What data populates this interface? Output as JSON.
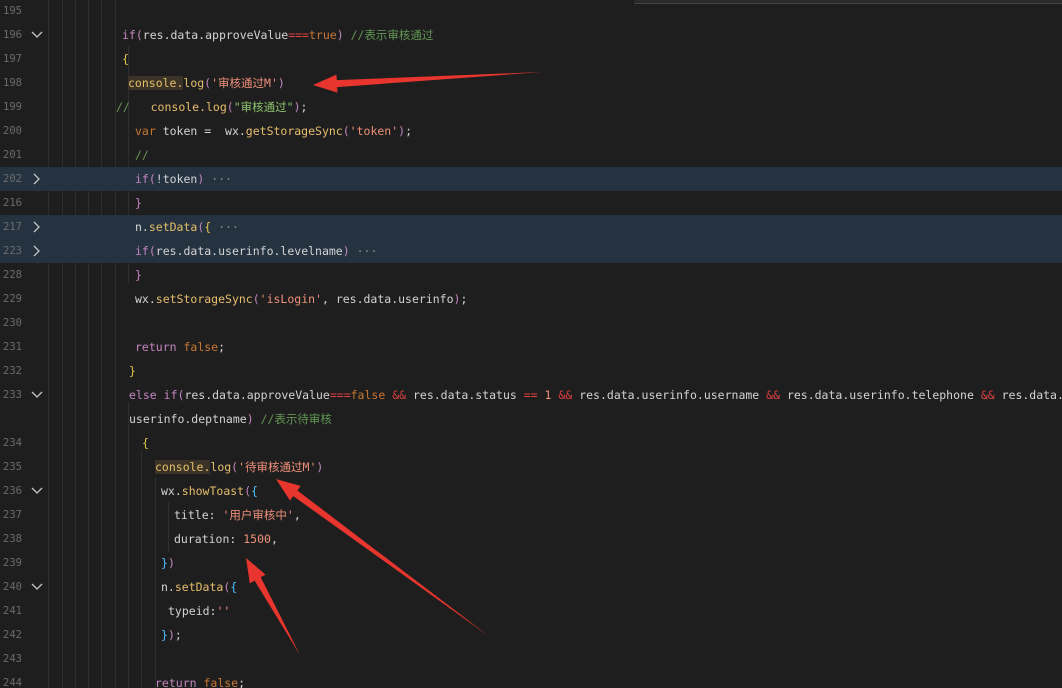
{
  "lines": [
    {
      "no": "195",
      "indent": 0,
      "segs": []
    },
    {
      "no": "196",
      "fold": "open",
      "indent": 122,
      "segs": [
        [
          "kw",
          "if"
        ],
        [
          "brk2",
          "("
        ],
        [
          "prop",
          "res.data.approveValue"
        ],
        [
          "op",
          "==="
        ],
        [
          "bool",
          "true"
        ],
        [
          "brk2",
          ")"
        ],
        [
          "plain",
          " "
        ],
        [
          "cm",
          "//表示审核通过"
        ]
      ]
    },
    {
      "no": "197",
      "indent": 122,
      "segs": [
        [
          "brk1",
          "{"
        ]
      ]
    },
    {
      "no": "198",
      "indent": 128,
      "segs": [
        [
          "hlfn",
          "console."
        ],
        [
          "fn",
          "log"
        ],
        [
          "brk2",
          "("
        ],
        [
          "str",
          "'审核通过M'"
        ],
        [
          "brk2",
          ")"
        ]
      ]
    },
    {
      "no": "199",
      "indent": 116,
      "segs": [
        [
          "cm",
          "//   "
        ],
        [
          "fn",
          "console.log"
        ],
        [
          "brk2",
          "("
        ],
        [
          "strg",
          "\"审核通过\""
        ],
        [
          "brk2",
          ")"
        ],
        [
          "plain",
          ";"
        ]
      ]
    },
    {
      "no": "200",
      "indent": 135,
      "segs": [
        [
          "kw2",
          "var"
        ],
        [
          "plain",
          " token =  wx."
        ],
        [
          "fn",
          "getStorageSync"
        ],
        [
          "brk2",
          "("
        ],
        [
          "str",
          "'token'"
        ],
        [
          "brk2",
          ")"
        ],
        [
          "plain",
          ";"
        ]
      ]
    },
    {
      "no": "201",
      "indent": 135,
      "segs": [
        [
          "cm",
          "//"
        ]
      ]
    },
    {
      "no": "202",
      "fold": "closed",
      "hl": true,
      "indent": 135,
      "segs": [
        [
          "kw",
          "if"
        ],
        [
          "brk2",
          "("
        ],
        [
          "plain",
          "!token"
        ],
        [
          "brk2",
          ")"
        ],
        [
          "ell",
          " ···"
        ]
      ]
    },
    {
      "no": "216",
      "indent": 135,
      "segs": [
        [
          "brk2",
          "}"
        ]
      ]
    },
    {
      "no": "217",
      "fold": "closed",
      "hl": true,
      "indent": 135,
      "segs": [
        [
          "plain",
          "n."
        ],
        [
          "fn",
          "setData"
        ],
        [
          "brk2",
          "("
        ],
        [
          "brk1",
          "{"
        ],
        [
          "ell",
          " ···"
        ]
      ]
    },
    {
      "no": "223",
      "fold": "closed",
      "hl": true,
      "indent": 135,
      "segs": [
        [
          "kw",
          "if"
        ],
        [
          "brk2",
          "("
        ],
        [
          "plain",
          "res.data.userinfo.levelname"
        ],
        [
          "brk2",
          ")"
        ],
        [
          "ell",
          " ···"
        ]
      ]
    },
    {
      "no": "228",
      "indent": 135,
      "segs": [
        [
          "brk2",
          "}"
        ]
      ]
    },
    {
      "no": "229",
      "indent": 135,
      "segs": [
        [
          "plain",
          "wx."
        ],
        [
          "fn",
          "setStorageSync"
        ],
        [
          "brk2",
          "("
        ],
        [
          "str",
          "'isLogin'"
        ],
        [
          "plain",
          ", res.data.userinfo"
        ],
        [
          "brk2",
          ")"
        ],
        [
          "plain",
          ";"
        ]
      ]
    },
    {
      "no": "230",
      "indent": 0,
      "segs": []
    },
    {
      "no": "231",
      "indent": 135,
      "segs": [
        [
          "kw",
          "return"
        ],
        [
          "plain",
          " "
        ],
        [
          "bool",
          "false"
        ],
        [
          "plain",
          ";"
        ]
      ]
    },
    {
      "no": "232",
      "indent": 129,
      "segs": [
        [
          "brk1",
          "}"
        ]
      ]
    },
    {
      "no": "233",
      "fold": "open",
      "indent": 129,
      "segs": [
        [
          "kw",
          "else"
        ],
        [
          "plain",
          " "
        ],
        [
          "kw",
          "if"
        ],
        [
          "brk2",
          "("
        ],
        [
          "plain",
          "res.data.approveValue"
        ],
        [
          "op",
          "==="
        ],
        [
          "bool",
          "false"
        ],
        [
          "plain",
          " "
        ],
        [
          "op",
          "&&"
        ],
        [
          "plain",
          " res.data.status "
        ],
        [
          "op",
          "=="
        ],
        [
          "plain",
          " "
        ],
        [
          "num",
          "1"
        ],
        [
          "plain",
          " "
        ],
        [
          "op",
          "&&"
        ],
        [
          "plain",
          " res.data.userinfo.username "
        ],
        [
          "op",
          "&&"
        ],
        [
          "plain",
          " res.data.userinfo.telephone "
        ],
        [
          "op",
          "&&"
        ],
        [
          "plain",
          " res.data."
        ]
      ]
    },
    {
      "no": "",
      "indent": 129,
      "segs": [
        [
          "plain",
          "userinfo.deptname"
        ],
        [
          "brk2",
          ")"
        ],
        [
          "plain",
          " "
        ],
        [
          "cm",
          "//表示待审核"
        ]
      ]
    },
    {
      "no": "234",
      "indent": 142,
      "segs": [
        [
          "brk1",
          "{"
        ]
      ]
    },
    {
      "no": "235",
      "indent": 155,
      "segs": [
        [
          "hlfn",
          "console."
        ],
        [
          "fn",
          "log"
        ],
        [
          "brk2",
          "("
        ],
        [
          "str",
          "'待审核通过M'"
        ],
        [
          "brk2",
          ")"
        ]
      ]
    },
    {
      "no": "236",
      "fold": "open",
      "indent": 161,
      "segs": [
        [
          "plain",
          "wx."
        ],
        [
          "fn",
          "showToast"
        ],
        [
          "brk2",
          "("
        ],
        [
          "brk3",
          "{"
        ]
      ]
    },
    {
      "no": "237",
      "indent": 174,
      "segs": [
        [
          "plain",
          "title: "
        ],
        [
          "str",
          "'用户审核中'"
        ],
        [
          "plain",
          ","
        ]
      ]
    },
    {
      "no": "238",
      "indent": 174,
      "segs": [
        [
          "plain",
          "duration: "
        ],
        [
          "num",
          "1500"
        ],
        [
          "plain",
          ","
        ]
      ]
    },
    {
      "no": "239",
      "indent": 161,
      "segs": [
        [
          "brk3",
          "}"
        ],
        [
          "brk2",
          ")"
        ]
      ]
    },
    {
      "no": "240",
      "fold": "open",
      "indent": 161,
      "segs": [
        [
          "plain",
          "n."
        ],
        [
          "fn",
          "setData"
        ],
        [
          "brk2",
          "("
        ],
        [
          "brk3",
          "{"
        ]
      ]
    },
    {
      "no": "241",
      "indent": 168,
      "segs": [
        [
          "plain",
          "typeid:"
        ],
        [
          "str",
          "''"
        ]
      ]
    },
    {
      "no": "242",
      "indent": 161,
      "segs": [
        [
          "brk3",
          "}"
        ],
        [
          "brk2",
          ")"
        ],
        [
          "plain",
          ";"
        ]
      ]
    },
    {
      "no": "243",
      "indent": 0,
      "segs": []
    },
    {
      "no": "244",
      "indent": 155,
      "segs": [
        [
          "kw",
          "return"
        ],
        [
          "plain",
          " "
        ],
        [
          "bool",
          "false"
        ],
        [
          "plain",
          ";"
        ]
      ]
    }
  ],
  "annotation_color": "#e8352e"
}
